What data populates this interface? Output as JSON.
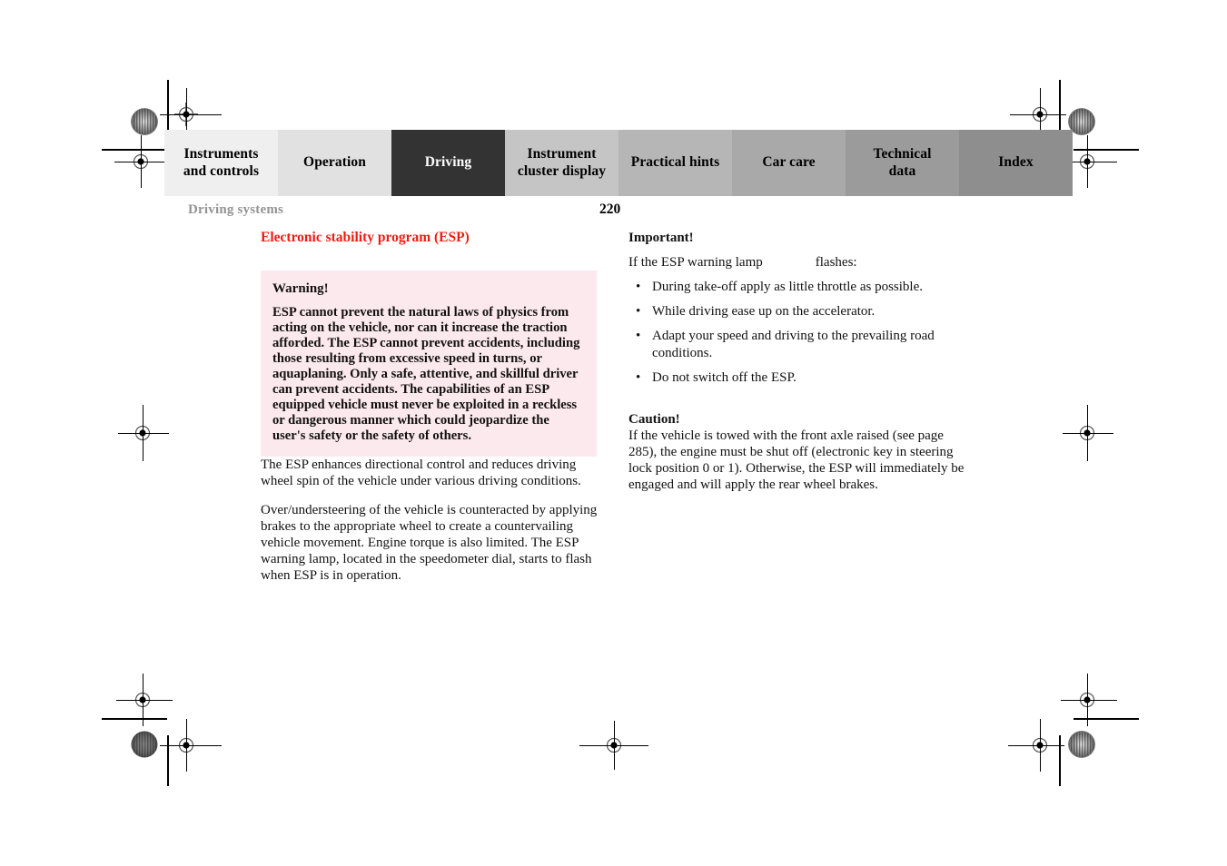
{
  "document": {
    "running_header": "Driving systems",
    "page_number": "220"
  },
  "tabs": [
    {
      "label": "Instruments\nand controls",
      "color": "#efefef",
      "active": false
    },
    {
      "label": "Operation",
      "color": "#e1e1e1",
      "active": false
    },
    {
      "label": "Driving",
      "color": "#333333",
      "active": true
    },
    {
      "label": "Instrument\ncluster display",
      "color": "#c5c5c5",
      "active": false
    },
    {
      "label": "Practical hints",
      "color": "#b6b6b6",
      "active": false
    },
    {
      "label": "Car care",
      "color": "#a9a9a9",
      "active": false
    },
    {
      "label": "Technical\ndata",
      "color": "#9b9b9b",
      "active": false
    },
    {
      "label": "Index",
      "color": "#8e8e8e",
      "active": false
    }
  ],
  "left_column": {
    "section_title": "Electronic stability program (ESP)",
    "warning": {
      "title": "Warning!",
      "text": "ESP cannot prevent the natural laws of physics from acting on the vehicle, nor can it increase the traction afforded. The ESP cannot prevent accidents, including those resulting from excessive speed in turns, or aquaplaning. Only a safe, attentive, and skillful driver can prevent accidents. The capabilities of an ESP equipped vehicle must never be exploited in a reckless or dangerous manner which could jeopardize the user's safety or the safety of others.",
      "background": "#fce9ee"
    },
    "paragraphs": [
      "The ESP enhances directional control and reduces driving wheel spin of the vehicle under various driving conditions.",
      "Over/understeering of the vehicle is counteracted by applying brakes to the appropriate wheel to create a countervailing vehicle movement. Engine torque is also limited. The ESP warning lamp, located in the speedometer dial, starts to flash when ESP is in operation."
    ]
  },
  "right_column": {
    "important": {
      "title": "Important!",
      "lead_before": "If the ESP warning lamp",
      "lead_after": "flashes:",
      "bullets": [
        "During take-off apply as little throttle as possible.",
        "While driving ease up on the accelerator.",
        "Adapt your speed and driving to the prevailing road conditions.",
        "Do not switch off the ESP."
      ],
      "bullet_glyph": "•"
    },
    "caution": {
      "title": "Caution!",
      "text": "If the vehicle is towed with the front axle raised (see page 285), the engine must be shut off (electronic key in steering lock position 0 or 1). Otherwise, the ESP will immediately be engaged and will apply the rear wheel brakes."
    }
  },
  "colors": {
    "accent_red": "#ee1c12",
    "header_gray": "#939393",
    "active_tab": "#333333"
  }
}
